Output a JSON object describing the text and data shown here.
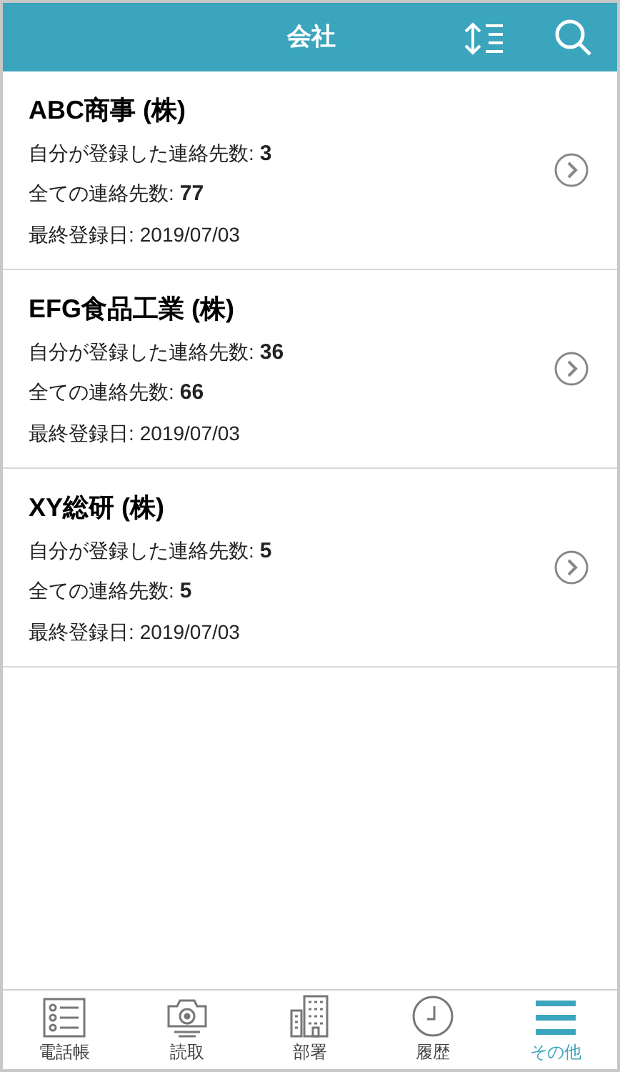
{
  "header": {
    "title": "会社"
  },
  "companies": [
    {
      "name": "ABC商事 (株)",
      "stats": [
        {
          "kind": "count",
          "label": "自分が登録した連絡先数:",
          "value": "3"
        },
        {
          "kind": "count",
          "label": "全ての連絡先数:",
          "value": "77"
        },
        {
          "kind": "date",
          "label": "最終登録日:",
          "value": "2019/07/03"
        }
      ]
    },
    {
      "name": "EFG食品工業 (株)",
      "stats": [
        {
          "kind": "count",
          "label": "自分が登録した連絡先数:",
          "value": "36"
        },
        {
          "kind": "count",
          "label": "全ての連絡先数:",
          "value": "66"
        },
        {
          "kind": "date",
          "label": "最終登録日:",
          "value": "2019/07/03"
        }
      ]
    },
    {
      "name": "XY総研 (株)",
      "stats": [
        {
          "kind": "count",
          "label": "自分が登録した連絡先数:",
          "value": "5"
        },
        {
          "kind": "count",
          "label": "全ての連絡先数:",
          "value": "5"
        },
        {
          "kind": "date",
          "label": "最終登録日:",
          "value": "2019/07/03"
        }
      ]
    }
  ],
  "nav": [
    {
      "label": "電話帳",
      "selected": false
    },
    {
      "label": "読取",
      "selected": false
    },
    {
      "label": "部署",
      "selected": false
    },
    {
      "label": "履歴",
      "selected": false
    },
    {
      "label": "その他",
      "selected": true
    }
  ]
}
